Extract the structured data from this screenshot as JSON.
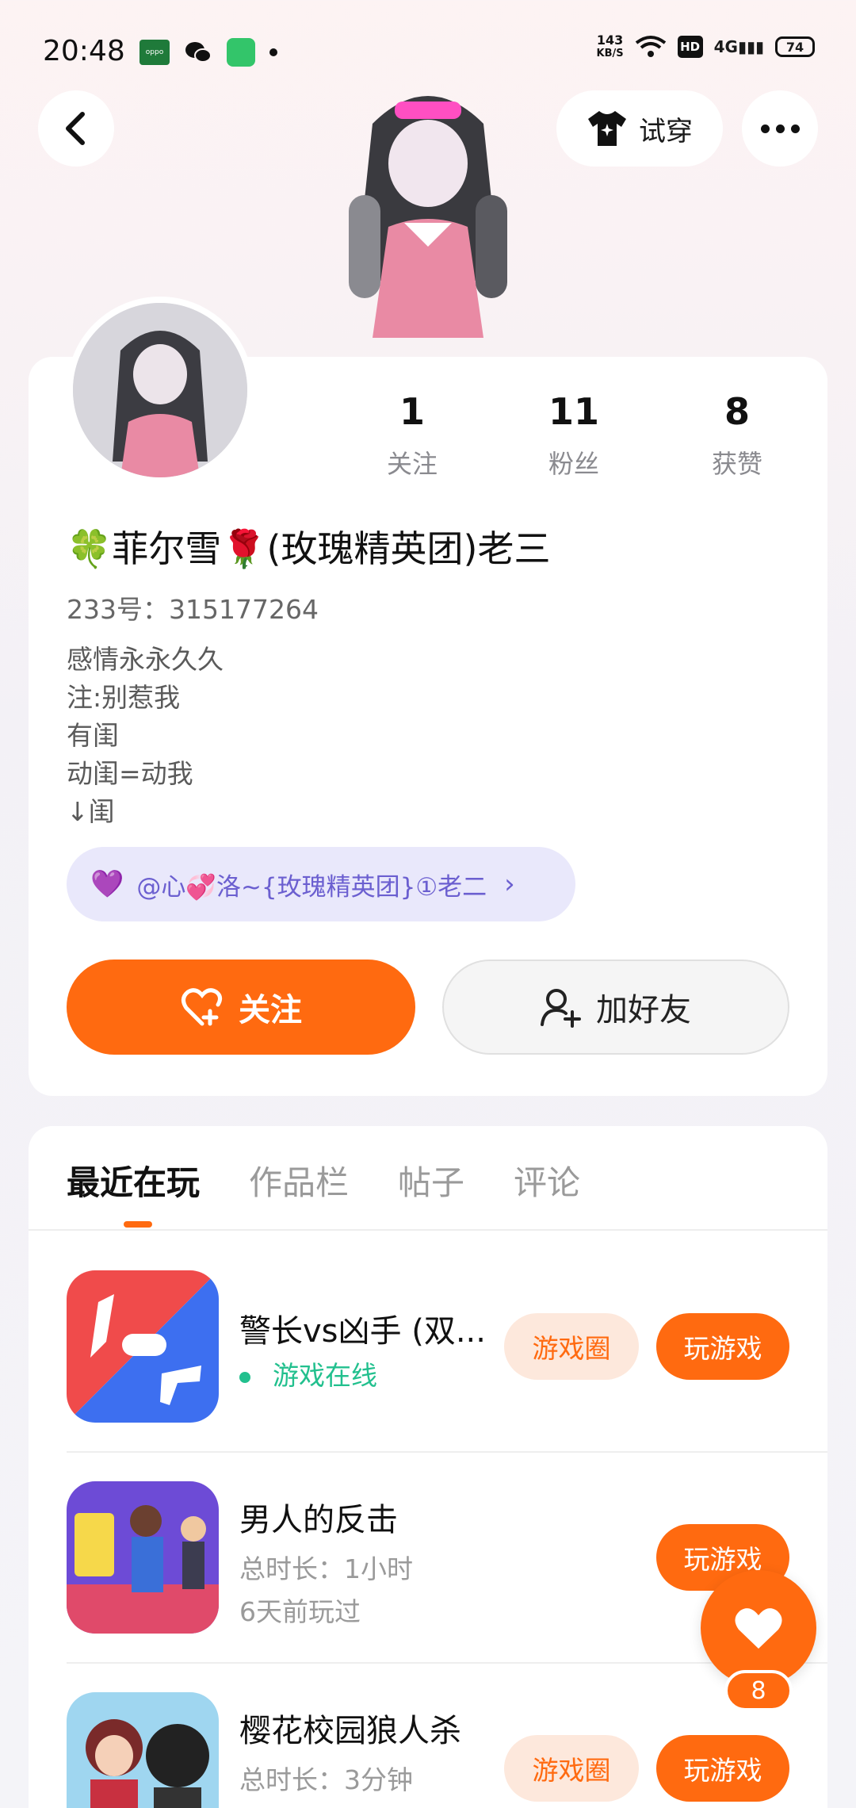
{
  "status_bar": {
    "time": "20:48",
    "oppo_label": "oppo",
    "net_speed_value": "143",
    "net_speed_unit": "KB/S",
    "hd_label": "HD",
    "signal_label": "4G",
    "battery": "74"
  },
  "header": {
    "tryon_label": "试穿"
  },
  "profile": {
    "stats": [
      {
        "value": "1",
        "label": "关注"
      },
      {
        "value": "11",
        "label": "粉丝"
      },
      {
        "value": "8",
        "label": "获赞"
      }
    ],
    "username": "🍀菲尔雪🌹(玫瑰精英团)老三",
    "uid": "233号：315177264",
    "bio": [
      "感情永永久久",
      "注:别惹我",
      "有闺",
      "动闺=动我",
      "↓闺"
    ],
    "relation": {
      "emoji": "💜",
      "text": "@心💞洛~{玫瑰精英团}①老二"
    },
    "follow_label": "关注",
    "add_friend_label": "加好友"
  },
  "tabs": [
    {
      "label": "最近在玩",
      "active": true
    },
    {
      "label": "作品栏",
      "active": false
    },
    {
      "label": "帖子",
      "active": false
    },
    {
      "label": "评论",
      "active": false
    }
  ],
  "games": [
    {
      "title": "警长vs凶手 (双...",
      "sub1": "游戏在线",
      "circle_label": "游戏圈",
      "play_label": "玩游戏"
    },
    {
      "title": "男人的反击",
      "sub1": "总时长：1小时",
      "sub2": "6天前玩过",
      "play_label": "玩游戏"
    },
    {
      "title": "樱花校园狼人杀",
      "sub1": "总时长：3分钟",
      "circle_label": "游戏圈",
      "play_label": "玩游戏"
    }
  ],
  "fab": {
    "count": "8"
  },
  "colors": {
    "accent": "#ff6a10",
    "online": "#22c08e",
    "relation_text": "#6b5fd0"
  }
}
